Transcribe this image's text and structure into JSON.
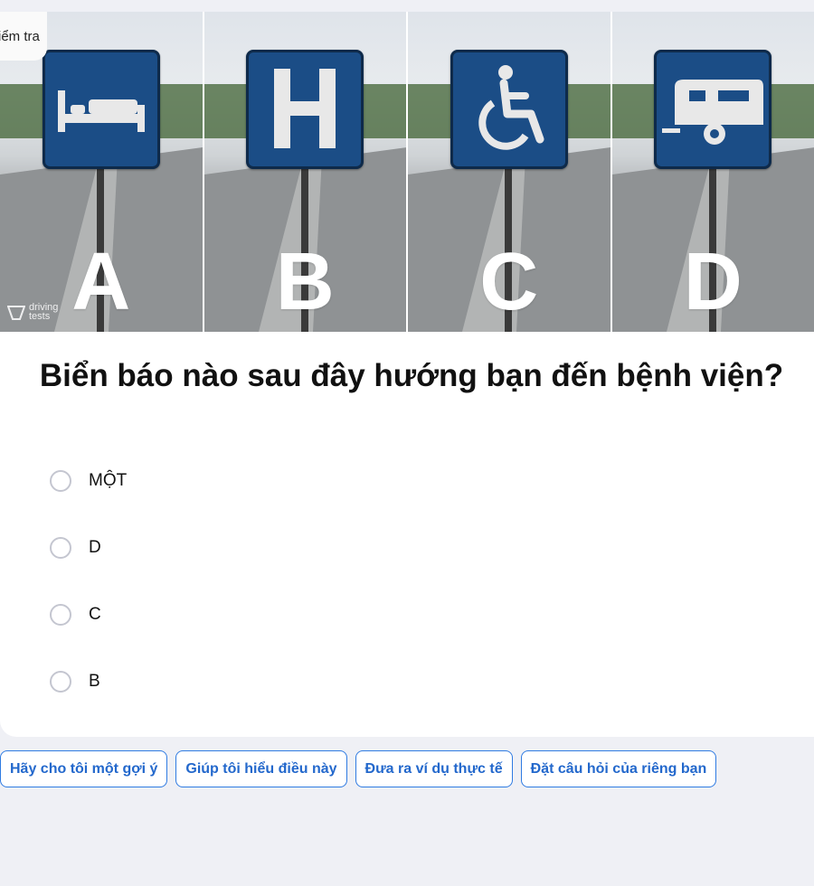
{
  "tab": {
    "label": "Kiểm tra"
  },
  "watermark": {
    "line1": "driving",
    "line2": "tests"
  },
  "signs": [
    {
      "letter": "A",
      "icon": "bed-icon"
    },
    {
      "letter": "B",
      "icon": "hospital-h-icon"
    },
    {
      "letter": "C",
      "icon": "wheelchair-icon"
    },
    {
      "letter": "D",
      "icon": "caravan-icon"
    }
  ],
  "question": "Biển báo nào sau đây hướng bạn đến bệnh viện?",
  "options": [
    "MỘT",
    "D",
    "C",
    "B"
  ],
  "suggestions": [
    "Hãy cho tôi một gợi ý",
    "Giúp tôi hiểu điều này",
    "Đưa ra ví dụ thực tế",
    "Đặt câu hỏi của riêng bạn"
  ],
  "colors": {
    "sign_blue": "#1b4d86",
    "accent": "#2f7be2",
    "background": "#eff0f5"
  }
}
